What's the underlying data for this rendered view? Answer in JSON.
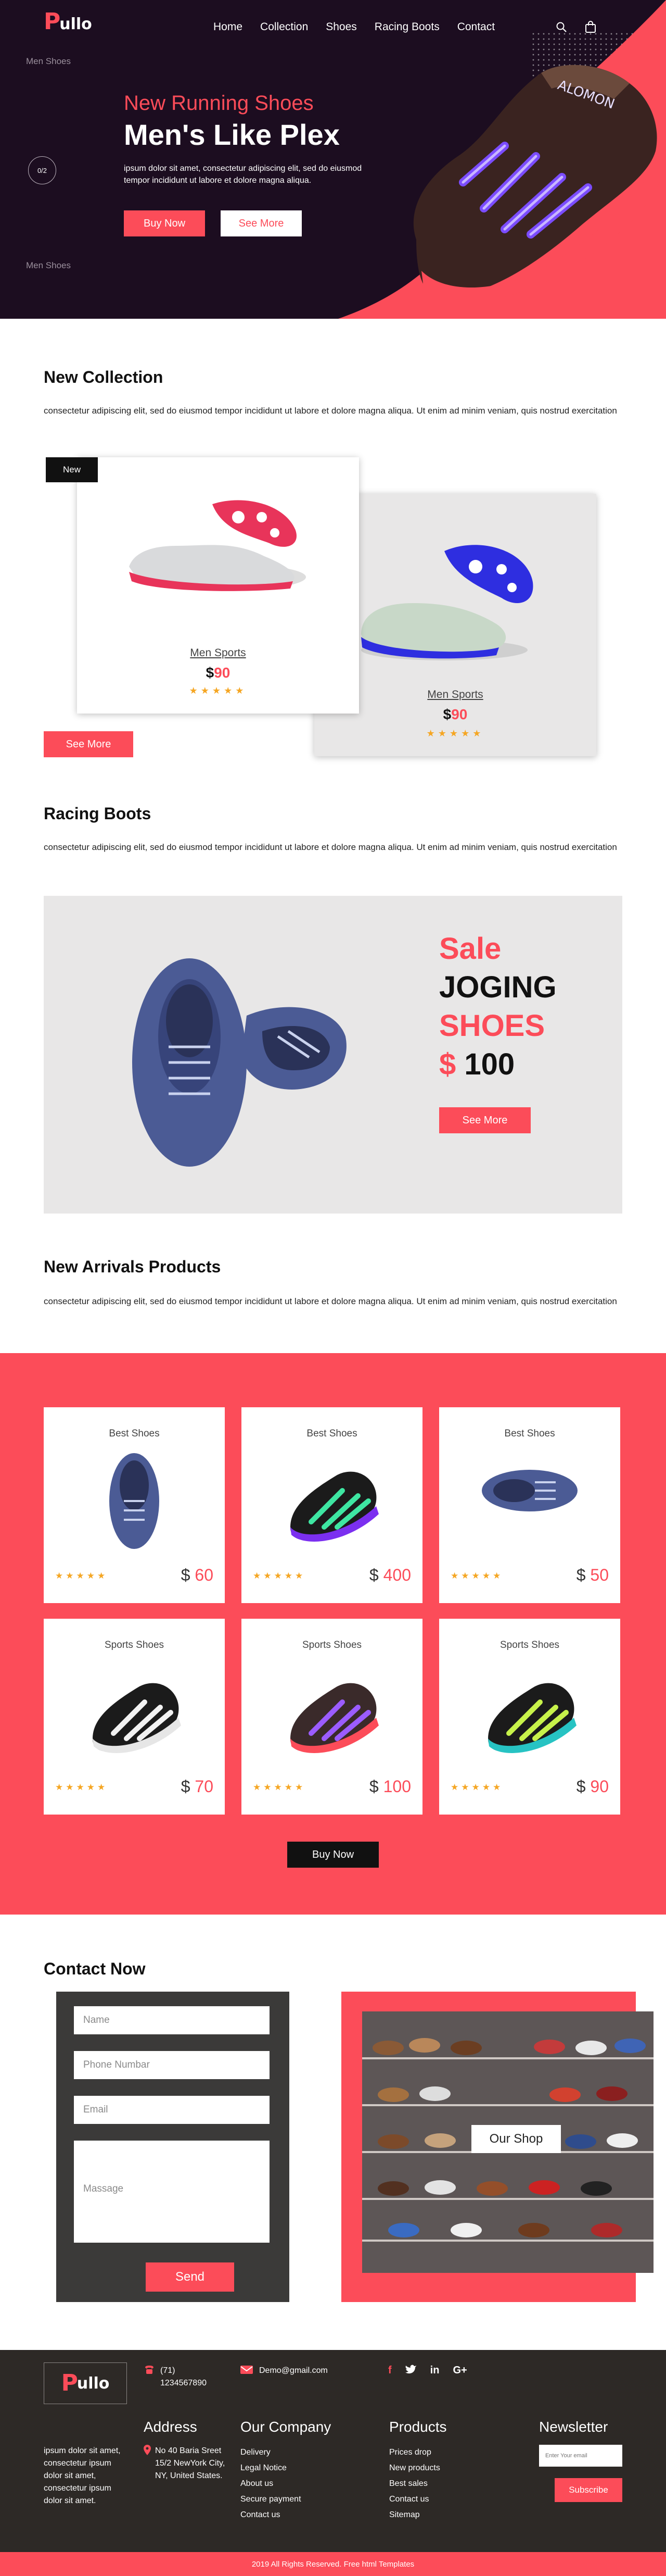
{
  "brand": {
    "logo_initial": "P",
    "logo_rest": "ullo",
    "accent_color": "#fc4c59",
    "dark_color": "#1c0d20"
  },
  "nav": {
    "items": [
      "Home",
      "Collection",
      "Shoes",
      "Racing Boots",
      "Contact"
    ],
    "search_icon": "search-icon",
    "cart_icon": "shopping-bag-icon"
  },
  "hero": {
    "side_label_top": "Men Shoes",
    "side_label_bottom": "Men Shoes",
    "slide_counter": "0/2",
    "subtitle": "New Running Shoes",
    "title": "Men's Like Plex",
    "text": "ipsum dolor sit amet, consectetur adipiscing elit, sed do eiusmod tempor incididunt ut labore et dolore magna aliqua.",
    "buy_label": "Buy Now",
    "more_label": "See More"
  },
  "new_collection": {
    "title": "New Collection",
    "text": "consectetur adipiscing elit, sed do eiusmod tempor incididunt ut labore et dolore magna aliqua. Ut enim ad minim veniam, quis nostrud exercitation",
    "badge": "New",
    "cards": [
      {
        "name": "Men Sports",
        "currency": "$",
        "price": "90",
        "rating": 5
      },
      {
        "name": "Men Sports",
        "currency": "$",
        "price": "90",
        "rating": 5
      }
    ],
    "more_label": "See More"
  },
  "racing": {
    "title": "Racing Boots",
    "text": "consectetur adipiscing elit, sed do eiusmod tempor incididunt ut labore et dolore magna aliqua. Ut enim ad minim veniam, quis nostrud exercitation",
    "sale": {
      "line1": "Sale",
      "line2": "JOGING",
      "line3": "SHOES",
      "currency": "$",
      "price": "100",
      "button": "See More"
    }
  },
  "arrivals": {
    "title": "New Arrivals Products",
    "text": "consectetur adipiscing elit, sed do eiusmod tempor incididunt ut labore et dolore magna aliqua. Ut enim ad minim veniam, quis nostrud exercitation",
    "products": [
      {
        "category": "Best Shoes",
        "currency": "$",
        "price": "60",
        "rating": 5
      },
      {
        "category": "Best Shoes",
        "currency": "$",
        "price": "400",
        "rating": 5
      },
      {
        "category": "Best Shoes",
        "currency": "$",
        "price": "50",
        "rating": 5
      },
      {
        "category": "Sports Shoes",
        "currency": "$",
        "price": "70",
        "rating": 5
      },
      {
        "category": "Sports Shoes",
        "currency": "$",
        "price": "100",
        "rating": 5
      },
      {
        "category": "Sports Shoes",
        "currency": "$",
        "price": "90",
        "rating": 5
      }
    ],
    "buy_label": "Buy Now"
  },
  "contact": {
    "title": "Contact Now",
    "name_placeholder": "Name",
    "phone_placeholder": "Phone Numbar",
    "email_placeholder": "Email",
    "message_placeholder": "Massage",
    "send_label": "Send",
    "shop_label": "Our Shop"
  },
  "footer": {
    "phone_prefix": "(71)",
    "phone": "1234567890",
    "email": "Demo@gmail.com",
    "socials": [
      "f",
      "t",
      "in",
      "G+"
    ],
    "about_text": "ipsum dolor sit amet, consectetur ipsum dolor sit amet, consectetur ipsum dolor sit amet.",
    "address_title": "Address",
    "address": "No 40 Baria Sreet 15/2 NewYork City, NY, United States.",
    "company_title": "Our Company",
    "company_links": [
      "Delivery",
      "Legal Notice",
      "About us",
      "Secure payment",
      "Contact us"
    ],
    "products_title": "Products",
    "product_links": [
      "Prices drop",
      "New products",
      "Best sales",
      "Contact us",
      "Sitemap"
    ],
    "newsletter_title": "Newsletter",
    "newsletter_placeholder": "Enter Your email",
    "subscribe_label": "Subscribe",
    "copyright": "2019 All Rights Reserved. Free html Templates"
  }
}
